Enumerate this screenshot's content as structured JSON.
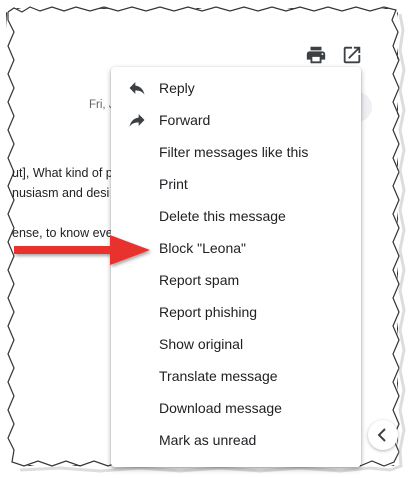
{
  "toolbar": {
    "print_icon": "print-icon",
    "open_new_window_icon": "open-in-new-window-icon"
  },
  "background": {
    "date_fragment": "Fri, J",
    "line1": "ut], What kind of p",
    "line2": "nusiasm and desi",
    "line3": "ense, to know eve"
  },
  "menu": {
    "items": [
      {
        "label": "Reply",
        "icon": "reply-icon"
      },
      {
        "label": "Forward",
        "icon": "forward-icon"
      },
      {
        "label": "Filter messages like this"
      },
      {
        "label": "Print"
      },
      {
        "label": "Delete this message"
      },
      {
        "label": "Block \"Leona\""
      },
      {
        "label": "Report spam"
      },
      {
        "label": "Report phishing"
      },
      {
        "label": "Show original"
      },
      {
        "label": "Translate message"
      },
      {
        "label": "Download message"
      },
      {
        "label": "Mark as unread"
      }
    ]
  },
  "annotation": {
    "arrow_color": "#e8302f",
    "points_to": "Block \"Leona\""
  },
  "side_panel_toggle": {
    "icon": "chevron-left-icon"
  }
}
